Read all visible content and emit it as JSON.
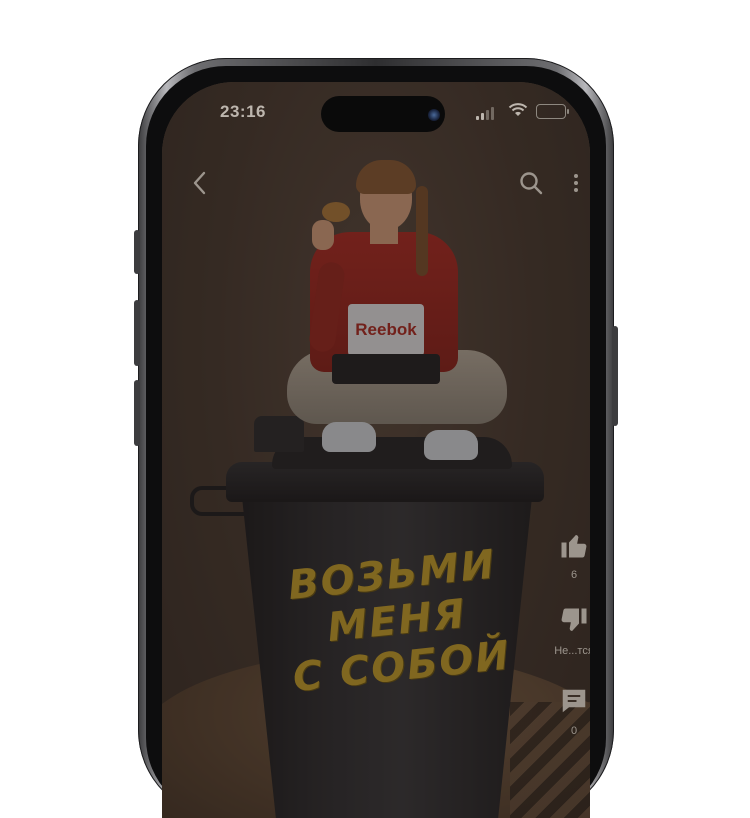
{
  "status_bar": {
    "time": "23:16"
  },
  "actions": {
    "like": {
      "count": "6",
      "icon": "thumbs-up-icon"
    },
    "dislike": {
      "label": "Не...тся",
      "icon": "thumbs-down-icon"
    },
    "comment": {
      "count": "0",
      "icon": "comment-icon"
    }
  },
  "nav": {
    "back_icon": "chevron-left-icon",
    "search_icon": "search-icon",
    "more_icon": "more-vertical-icon"
  },
  "media": {
    "slogan_lines": [
      "ВОЗЬМИ",
      "МЕНЯ",
      "С СОБОЙ"
    ],
    "hoodie_brand": "Reebok"
  },
  "colors": {
    "slogan": "#c9a32a",
    "overlay": "rgba(28,22,18,0.42)",
    "hoodie": "#b02a22"
  }
}
